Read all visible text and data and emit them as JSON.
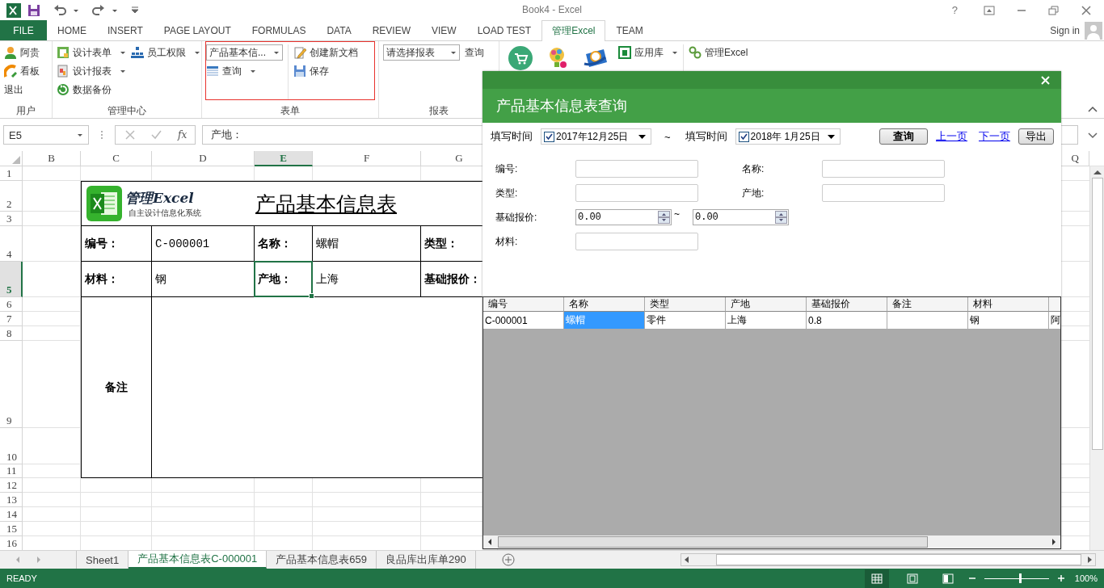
{
  "window": {
    "title": "Book4 - Excel",
    "help": "?"
  },
  "ribbon_tabs": [
    {
      "label": "FILE",
      "kind": "file",
      "selected": false
    },
    {
      "label": "HOME",
      "kind": "tab",
      "selected": false
    },
    {
      "label": "INSERT",
      "kind": "tab",
      "selected": false
    },
    {
      "label": "PAGE LAYOUT",
      "kind": "tab",
      "selected": false
    },
    {
      "label": "FORMULAS",
      "kind": "tab",
      "selected": false
    },
    {
      "label": "DATA",
      "kind": "tab",
      "selected": false
    },
    {
      "label": "REVIEW",
      "kind": "tab",
      "selected": false
    },
    {
      "label": "VIEW",
      "kind": "tab",
      "selected": false
    },
    {
      "label": "LOAD TEST",
      "kind": "tab",
      "selected": false
    },
    {
      "label": "管理Excel",
      "kind": "tab",
      "selected": true
    },
    {
      "label": "TEAM",
      "kind": "tab",
      "selected": false
    }
  ],
  "sign_in": "Sign in",
  "ribbon_groups": [
    {
      "label": "用户",
      "columns": [
        [
          {
            "label": "阿贵",
            "kind": "button"
          },
          {
            "label": "看板",
            "kind": "button"
          },
          {
            "label": "退出",
            "kind": "text"
          }
        ]
      ]
    },
    {
      "label": "管理中心",
      "columns": [
        [
          {
            "label": "设计表单",
            "kind": "split"
          },
          {
            "label": "设计报表",
            "kind": "split"
          },
          {
            "label": "数据备份",
            "kind": "button"
          }
        ],
        [
          {
            "label": "员工权限",
            "kind": "split"
          }
        ]
      ]
    },
    {
      "label": "表单",
      "highlighted": true,
      "columns": [
        [
          {
            "label": "产品基本信...",
            "kind": "combo"
          },
          {
            "label": "查询",
            "kind": "split"
          }
        ],
        [
          {
            "label": "创建新文档",
            "kind": "button"
          },
          {
            "label": "保存",
            "kind": "button"
          }
        ]
      ]
    },
    {
      "label": "报表",
      "columns": [
        [
          {
            "label": "请选择报表",
            "kind": "combo"
          }
        ],
        [
          {
            "label": "查询",
            "kind": "text"
          }
        ]
      ]
    },
    {
      "columns": [
        [
          {
            "kind": "large"
          }
        ],
        [
          {
            "kind": "large"
          }
        ],
        [
          {
            "kind": "large"
          }
        ],
        [
          {
            "label": "应用库",
            "kind": "split"
          }
        ],
        [
          {
            "label": "管理Excel",
            "kind": "button"
          }
        ]
      ]
    }
  ],
  "formula_bar": {
    "name_box": "E5",
    "function_button": "fx",
    "content": "产地："
  },
  "sheet": {
    "columns": [
      {
        "label": "B",
        "selected": false
      },
      {
        "label": "C",
        "selected": false
      },
      {
        "label": "D",
        "selected": false
      },
      {
        "label": "E",
        "selected": true
      },
      {
        "label": "F",
        "selected": false
      },
      {
        "label": "G",
        "selected": false
      },
      {
        "label": "Q",
        "selected": false
      }
    ],
    "rows": [
      {
        "label": "1",
        "selected": false
      },
      {
        "label": "2",
        "selected": false
      },
      {
        "label": "3",
        "selected": false
      },
      {
        "label": "4",
        "selected": false
      },
      {
        "label": "5",
        "selected": true
      },
      {
        "label": "6",
        "selected": false
      },
      {
        "label": "7",
        "selected": false
      },
      {
        "label": "8",
        "selected": false
      },
      {
        "label": "9",
        "selected": false
      },
      {
        "label": "10",
        "selected": false
      },
      {
        "label": "11",
        "selected": false
      },
      {
        "label": "12",
        "selected": false
      },
      {
        "label": "13",
        "selected": false
      },
      {
        "label": "14",
        "selected": false
      },
      {
        "label": "15",
        "selected": false
      },
      {
        "label": "16",
        "selected": false
      }
    ],
    "form": {
      "logo_title": "管理Excel",
      "logo_subtitle": "自主设计信息化系统",
      "title": "产品基本信息表",
      "lines": [
        [
          {
            "text": "编号：",
            "kind": "label",
            "selected": false
          },
          {
            "text": "C-000001",
            "kind": "code",
            "selected": false
          },
          {
            "text": "名称：",
            "kind": "label",
            "selected": false
          },
          {
            "text": "螺帽",
            "kind": "value",
            "selected": false
          },
          {
            "text": "类型：",
            "kind": "label",
            "selected": false
          }
        ],
        [
          {
            "text": "材料：",
            "kind": "label",
            "selected": false
          },
          {
            "text": "钢",
            "kind": "value",
            "selected": false
          },
          {
            "text": "产地：",
            "kind": "label",
            "selected": true
          },
          {
            "text": "上海",
            "kind": "value",
            "selected": false
          },
          {
            "text": "基础报价：",
            "kind": "label",
            "selected": false
          }
        ]
      ],
      "remarks_label": "备注"
    }
  },
  "sheet_tabs": [
    {
      "label": "Sheet1",
      "selected": false
    },
    {
      "label": "产品基本信息表C-000001",
      "selected": true
    },
    {
      "label": "产品基本信息表659",
      "selected": false
    },
    {
      "label": "良品库出库单290",
      "selected": false
    }
  ],
  "status_bar": {
    "text": "READY",
    "zoom": "100%",
    "zoom_slider": {
      "level": 0.55
    }
  },
  "dialog": {
    "title": "产品基本信息表查询",
    "date_filters": [
      {
        "label": "填写时间",
        "checked": true,
        "value": "2017年12月25日"
      },
      {
        "label": "填写时间",
        "checked": true,
        "value": "2018年 1月25日"
      }
    ],
    "date_separator": "~",
    "actions": [
      {
        "label": "查询",
        "kind": "button"
      },
      {
        "label": "上一页",
        "kind": "link"
      },
      {
        "label": "下一页",
        "kind": "link"
      },
      {
        "label": "导出",
        "kind": "button"
      }
    ],
    "fields": [
      {
        "label": "编号:",
        "kind": "text"
      },
      {
        "label": "名称:",
        "kind": "text"
      },
      {
        "label": "类型:",
        "kind": "text"
      },
      {
        "label": "产地:",
        "kind": "text"
      },
      {
        "label": "基础报价:",
        "kind": "range",
        "from": "0.00",
        "separator": "~",
        "to": "0.00"
      },
      {
        "label": "材料:",
        "kind": "text"
      }
    ],
    "grid": {
      "columns": [
        "编号",
        "名称",
        "类型",
        "产地",
        "基础报价",
        "备注",
        "材料"
      ],
      "rows": [
        {
          "cells": [
            {
              "text": "C-000001",
              "selected": false
            },
            {
              "text": "螺帽",
              "selected": true
            },
            {
              "text": "零件",
              "selected": false
            },
            {
              "text": "上海",
              "selected": false
            },
            {
              "text": "0.8",
              "selected": false
            },
            {
              "selected": false
            },
            {
              "text": "钢",
              "selected": false
            },
            {
              "text": "阿",
              "selected": false
            }
          ]
        }
      ]
    }
  }
}
